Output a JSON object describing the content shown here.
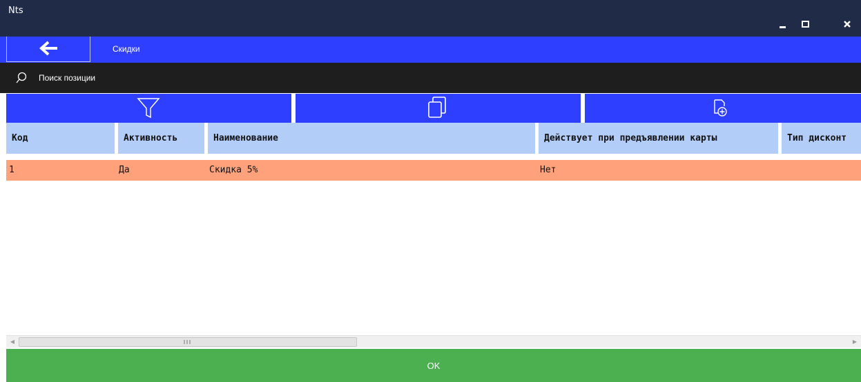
{
  "window": {
    "title": "Nts"
  },
  "nav": {
    "title": "Скидки"
  },
  "search": {
    "placeholder": "Поиск позиции"
  },
  "toolbar": {
    "buttons": [
      "filter-icon",
      "copy-icon",
      "add-document-icon"
    ]
  },
  "table": {
    "columns": [
      "Код",
      "Активность",
      "Наименование",
      "Действует при предъявлении карты",
      "Тип дисконт"
    ],
    "rows": [
      {
        "code": "1",
        "active": "Да",
        "name": "Скидка 5%",
        "card": "Нет",
        "type": ""
      }
    ]
  },
  "footer": {
    "ok_label": "OK"
  },
  "colors": {
    "titlebar": "#1f2b47",
    "accent": "#2f3fff",
    "search_bg": "#1e1e1e",
    "header": "#b3cdf9",
    "selected_row": "#ffa27c",
    "ok": "#4caf50"
  }
}
